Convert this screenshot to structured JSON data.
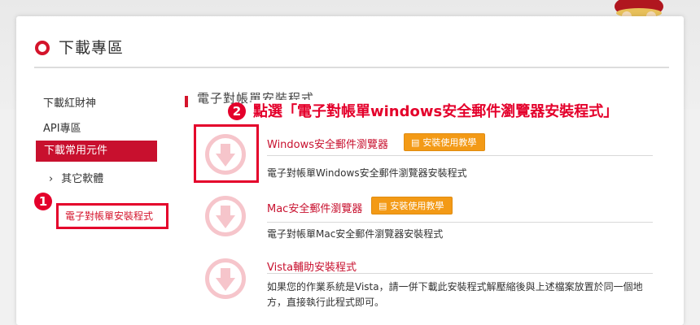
{
  "page": {
    "title": "下載專區"
  },
  "sidebar": {
    "items": [
      {
        "label": "下載紅財神"
      },
      {
        "label": "API專區"
      }
    ],
    "active": {
      "label": "下載常用元件"
    },
    "sub": {
      "label": "其它軟體",
      "chevron": "›"
    },
    "current": {
      "label": "電子對帳單安裝程式"
    }
  },
  "annotations": {
    "step1": {
      "number": "1"
    },
    "step2": {
      "number": "2",
      "text": "點選「電子對帳單windows安全郵件瀏覽器安裝程式」"
    }
  },
  "section": {
    "title": "電子對帳單安裝程式"
  },
  "downloads": [
    {
      "title": "Windows安全郵件瀏覽器",
      "button": "安裝使用教學",
      "desc": "電子對帳單Windows安全郵件瀏覽器安裝程式"
    },
    {
      "title": "Mac安全郵件瀏覽器",
      "button": "安裝使用教學",
      "desc": "電子對帳單Mac安全郵件瀏覽器安裝程式"
    },
    {
      "title": "Vista輔助安裝程式",
      "desc": "如果您的作業系統是Vista，請一併下載此安裝程式解壓縮後與上述檔案放置於同一個地方，直接執行此程式即可。"
    }
  ],
  "icons": {
    "download": "download-arrow-icon",
    "book": "book-icon",
    "title_marker": "circle-ring-icon"
  },
  "colors": {
    "accent": "#c8102e",
    "annotation": "#e4002b",
    "button": "#f39a16",
    "icon": "#f6c5cb"
  }
}
